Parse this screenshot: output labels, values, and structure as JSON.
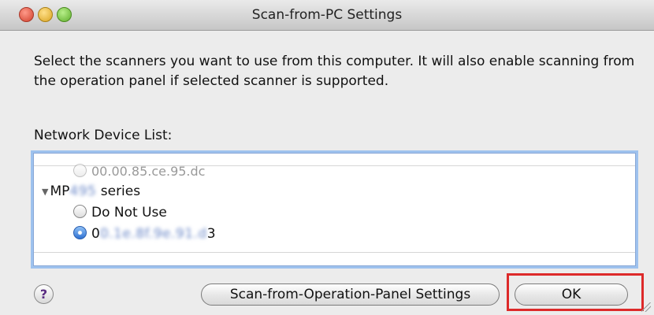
{
  "window": {
    "title": "Scan-from-PC Settings"
  },
  "description": "Select the scanners you want to use from this computer. It will also enable scanning from the operation panel if selected scanner is supported.",
  "device_list": {
    "label": "Network Device List:",
    "cut_off_row": "00.00.85.ce.95.dc",
    "group": {
      "prefix": "MP",
      "blurred_model": "495",
      "suffix": " series"
    },
    "options": [
      {
        "label": "Do Not Use",
        "selected": false
      },
      {
        "prefix": "0",
        "blurred": "0.1e.8f.9e.91.d",
        "suffix": "3",
        "selected": true
      }
    ]
  },
  "buttons": {
    "help": "?",
    "scan_from_operation_panel": "Scan-from-Operation-Panel Settings",
    "ok": "OK"
  },
  "colors": {
    "highlight": "#dd2a2a",
    "focus_ring": "#9ec2ee"
  }
}
